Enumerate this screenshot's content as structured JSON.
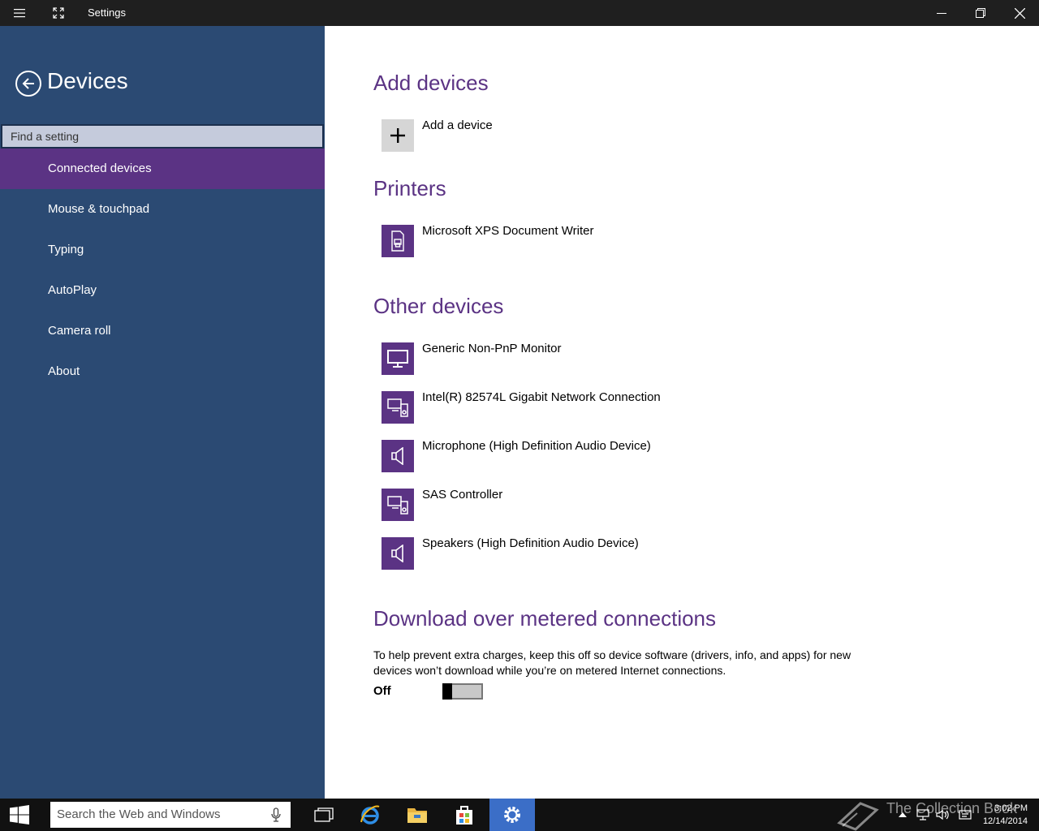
{
  "window": {
    "title": "Settings",
    "icons": [
      "hamburger-icon",
      "fullscreen-icon",
      "minimize-icon",
      "restore-icon",
      "close-icon"
    ]
  },
  "sidebar": {
    "title": "Devices",
    "search_placeholder": "Find a setting",
    "items": [
      {
        "label": "Connected devices",
        "active": true
      },
      {
        "label": "Mouse & touchpad"
      },
      {
        "label": "Typing"
      },
      {
        "label": "AutoPlay"
      },
      {
        "label": "Camera roll"
      },
      {
        "label": "About"
      }
    ]
  },
  "main": {
    "add_devices": {
      "heading": "Add devices",
      "add_label": "Add a device"
    },
    "printers": {
      "heading": "Printers",
      "items": [
        {
          "label": "Microsoft XPS Document Writer",
          "icon": "printer-icon"
        }
      ]
    },
    "other_devices": {
      "heading": "Other devices",
      "items": [
        {
          "label": "Generic Non-PnP Monitor",
          "icon": "monitor-icon"
        },
        {
          "label": "Intel(R) 82574L Gigabit Network Connection",
          "icon": "generic-device-icon"
        },
        {
          "label": "Microphone (High Definition Audio Device)",
          "icon": "speaker-icon"
        },
        {
          "label": "SAS Controller",
          "icon": "generic-device-icon"
        },
        {
          "label": "Speakers (High Definition Audio Device)",
          "icon": "speaker-icon"
        }
      ]
    },
    "metered": {
      "heading": "Download over metered connections",
      "description": "To help prevent extra charges, keep this off so device software (drivers, info, and apps) for new devices won’t download while you’re on metered Internet connections.",
      "toggle_label": "Off"
    }
  },
  "taskbar": {
    "search_placeholder": "Search the Web and Windows",
    "time": "3:02 PM",
    "date": "12/14/2014",
    "watermark": "The Collection Book"
  },
  "colors": {
    "sidebar": "#2b4a73",
    "accent": "#5b3384",
    "taskbar": "#111111",
    "active_taskbar_app": "#3b6ec7"
  }
}
